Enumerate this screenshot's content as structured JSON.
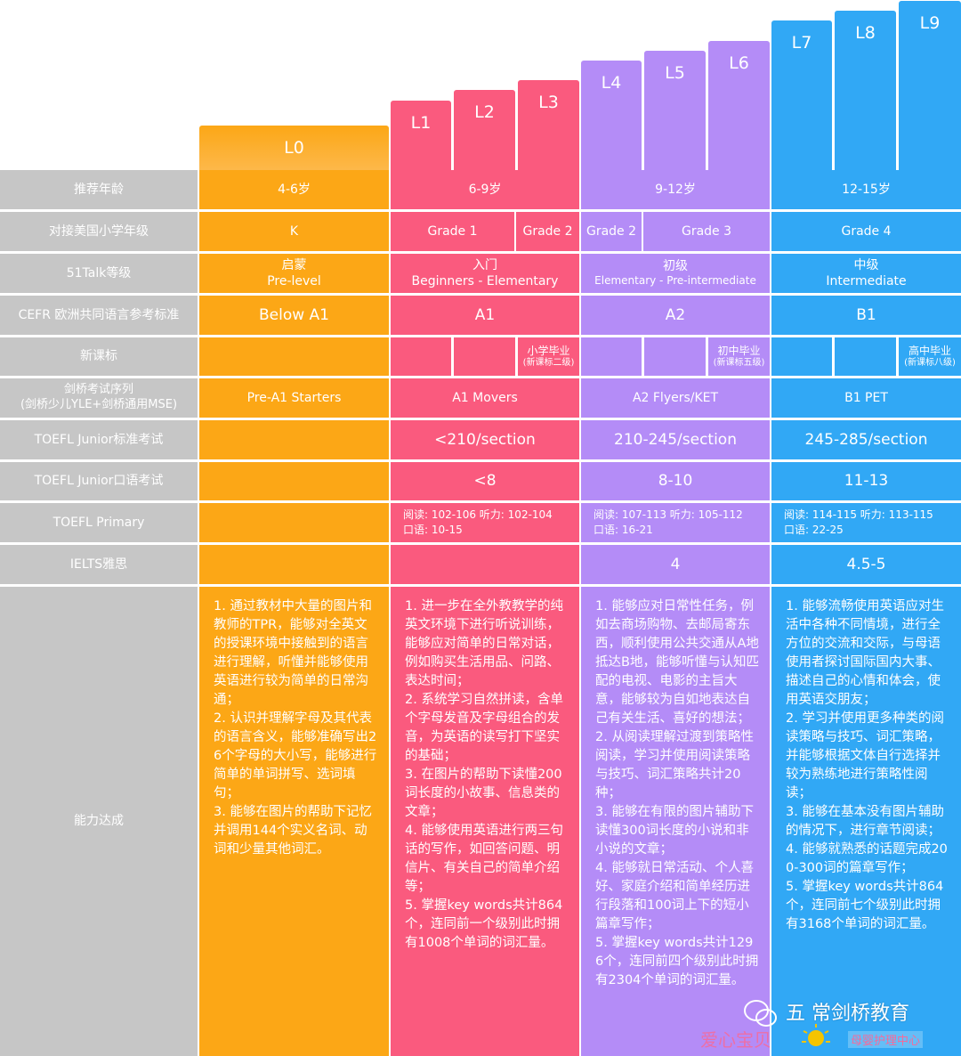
{
  "levels": [
    "L0",
    "L1",
    "L2",
    "L3",
    "L4",
    "L5",
    "L6",
    "L7",
    "L8",
    "L9"
  ],
  "labels": [
    "推荐年龄",
    "对接美国小学年级",
    "51Talk等级",
    "CEFR 欧洲共同语言参考标准",
    "新课标",
    "剑桥考试序列\n(剑桥少儿YLE+剑桥通用MSE)",
    "TOEFL Junior标准考试",
    "TOEFL Junior口语考试",
    "TOEFL Primary",
    "IELTS雅思",
    "能力达成"
  ],
  "age": [
    "4-6岁",
    "6-9岁",
    "9-12岁",
    "12-15岁"
  ],
  "grade": [
    "K",
    "Grade 1",
    "Grade 2",
    "Grade 2",
    "Grade 3",
    "Grade 4"
  ],
  "talk": [
    {
      "cn": "启蒙",
      "en": "Pre-level"
    },
    {
      "cn": "入门",
      "en": "Beginners - Elementary"
    },
    {
      "cn": "初级",
      "en": "Elementary - Pre-intermediate"
    },
    {
      "cn": "中级",
      "en": "Intermediate"
    }
  ],
  "cefr": [
    "Below A1",
    "A1",
    "A2",
    "B1"
  ],
  "newstd": [
    {
      "t": "小学毕业",
      "s": "(新课标二级)"
    },
    {
      "t": "初中毕业",
      "s": "(新课标五级)"
    },
    {
      "t": "高中毕业",
      "s": "(新课标八级)"
    }
  ],
  "cambridge": [
    "Pre-A1 Starters",
    "A1 Movers",
    "A2 Flyers/KET",
    "B1 PET"
  ],
  "tj_std": [
    "<210/section",
    "210-245/section",
    "245-285/section"
  ],
  "tj_oral": [
    "<8",
    "8-10",
    "11-13"
  ],
  "primary": [
    {
      "a": "阅读: 102-106    听力: 102-104",
      "b": "口语: 10-15"
    },
    {
      "a": "阅读: 107-113    听力: 105-112",
      "b": "口语: 16-21"
    },
    {
      "a": "阅读: 114-115    听力: 113-115",
      "b": "口语: 22-25"
    }
  ],
  "ielts": [
    "4",
    "4.5-5"
  ],
  "ability": [
    "1. 通过教材中大量的图片和教师的TPR，能够对全英文的授课环境中接触到的语言进行理解，听懂并能够使用英语进行较为简单的日常沟通；\n2. 认识并理解字母及其代表的语言含义，能够准确写出26个字母的大小写，能够进行简单的单词拼写、选词填句；\n3. 能够在图片的帮助下记忆并调用144个实义名词、动词和少量其他词汇。",
    "1. 进一步在全外教教学的纯英文环境下进行听说训练，能够应对简单的日常对话，例如购买生活用品、问路、表达时间；\n2. 系统学习自然拼读，含单个字母发音及字母组合的发音，为英语的读写打下坚实的基础；\n3. 在图片的帮助下读懂200词长度的小故事、信息类的文章；\n4. 能够使用英语进行两三句话的写作，如回答问题、明信片、有关自己的简单介绍等；\n5. 掌握key words共计864个，连同前一个级别此时拥有1008个单词的词汇量。",
    "1. 能够应对日常性任务，例如去商场购物、去邮局寄东西，顺利使用公共交通从A地抵达B地，能够听懂与认知匹配的电视、电影的主旨大意，能够较为自如地表达自己有关生活、喜好的想法；\n2. 从阅读理解过渡到策略性阅读，学习并使用阅读策略与技巧、词汇策略共计20种；\n3. 能够在有限的图片辅助下读懂300词长度的小说和非小说的文章；\n4. 能够就日常活动、个人喜好、家庭介绍和简单经历进行段落和100词上下的短小篇章写作；\n5. 掌握key words共计1296个，连同前四个级别此时拥有2304个单词的词汇量。",
    "1. 能够流畅使用英语应对生活中各种不同情境，进行全方位的交流和交际，与母语使用者探讨国际国内大事、描述自己的心情和体会，使用英语交朋友；\n2. 学习并使用更多种类的阅读策略与技巧、词汇策略，并能够根据文体自行选择并较为熟练地进行策略性阅读；\n3. 能够在基本没有图片辅助的情况下，进行章节阅读；\n4. 能够就熟悉的话题完成200-300词的篇章写作；\n5. 掌握key words共计864个，连同前七个级别此时拥有3168个单词的词汇量。"
  ],
  "watermark": {
    "brand": "五 常剑桥教育",
    "sub": "爱心宝贝",
    "sub2": "母婴护理中心"
  }
}
